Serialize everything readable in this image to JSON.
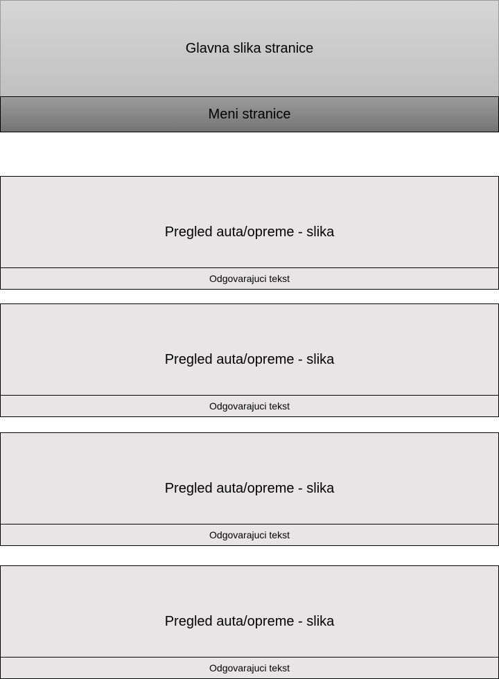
{
  "header": {
    "hero_label": "Glavna slika stranice",
    "menu_label": "Meni stranice"
  },
  "cards": [
    {
      "image_label": "Pregled auta/opreme - slika",
      "caption": "Odgovarajuci tekst"
    },
    {
      "image_label": "Pregled auta/opreme - slika",
      "caption": "Odgovarajuci tekst"
    },
    {
      "image_label": "Pregled auta/opreme - slika",
      "caption": "Odgovarajuci tekst"
    },
    {
      "image_label": "Pregled auta/opreme - slika",
      "caption": "Odgovarajuci tekst"
    }
  ]
}
